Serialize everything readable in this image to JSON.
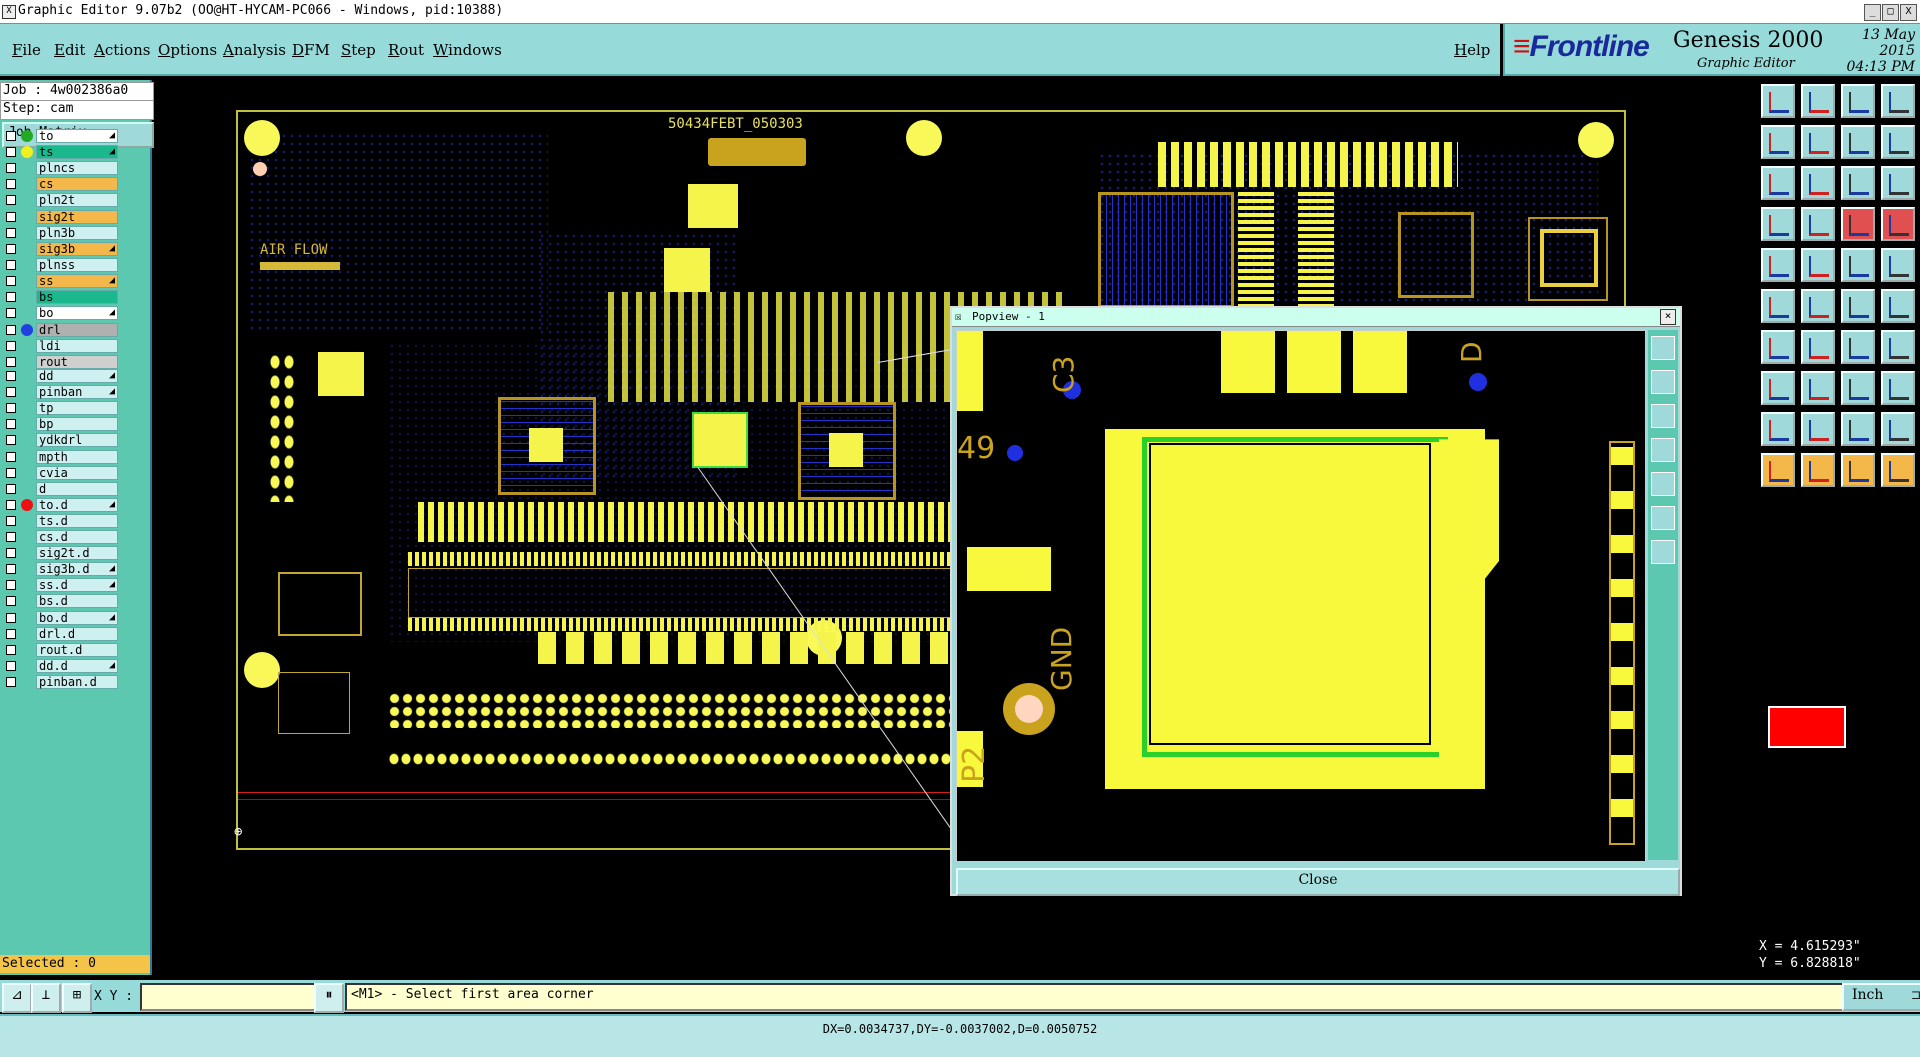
{
  "window": {
    "title": "Graphic Editor 9.07b2 (OO@HT-HYCAM-PC066 - Windows, pid:10388)",
    "buttons": [
      "_",
      "□",
      "X"
    ]
  },
  "menu": {
    "items": [
      "File",
      "Edit",
      "Actions",
      "Options",
      "Analysis",
      "DFM",
      "Step",
      "Rout",
      "Windows"
    ],
    "help": "Help"
  },
  "brand": {
    "logo": "Frontline",
    "product": "Genesis 2000",
    "subtitle": "Graphic Editor",
    "date": "13 May 2015",
    "time": "04:13 PM"
  },
  "job": {
    "job_label": "Job : 4w002386a0",
    "step_label": "Step: cam",
    "matrix_button": "Job Matrix ..."
  },
  "layers": [
    {
      "name": "to",
      "dot": "#22aa22",
      "color": "#ffffff",
      "arrow": true
    },
    {
      "name": "ts",
      "dot": "#f0f020",
      "color": "#1ab88c",
      "arrow": true
    },
    {
      "name": "plncs",
      "dot": "",
      "color": "#cff0f0",
      "arrow": false
    },
    {
      "name": "cs",
      "dot": "",
      "color": "#f4b84a",
      "arrow": false
    },
    {
      "name": "pln2t",
      "dot": "",
      "color": "#cff0f0",
      "arrow": false
    },
    {
      "name": "sig2t",
      "dot": "",
      "color": "#f4b84a",
      "arrow": false
    },
    {
      "name": "pln3b",
      "dot": "",
      "color": "#cff0f0",
      "arrow": false
    },
    {
      "name": "sig3b",
      "dot": "",
      "color": "#f4b84a",
      "arrow": true
    },
    {
      "name": "plnss",
      "dot": "",
      "color": "#cff0f0",
      "arrow": false
    },
    {
      "name": "ss",
      "dot": "",
      "color": "#f4b84a",
      "arrow": true
    },
    {
      "name": "bs",
      "dot": "",
      "color": "#1ab88c",
      "arrow": false
    },
    {
      "name": "bo",
      "dot": "",
      "color": "#ffffff",
      "arrow": true
    },
    {
      "name": "drl",
      "dot": "#2040e0",
      "color": "#b0b0b0",
      "arrow": false
    },
    {
      "name": "ldi",
      "dot": "",
      "color": "#cff0f0",
      "arrow": false
    },
    {
      "name": "rout",
      "dot": "",
      "color": "#cfcfcf",
      "arrow": false
    },
    {
      "name": "dd",
      "dot": "",
      "color": "#cff0f0",
      "arrow": true
    },
    {
      "name": "pinban",
      "dot": "",
      "color": "#cff0f0",
      "arrow": true
    },
    {
      "name": "tp",
      "dot": "",
      "color": "#cff0f0",
      "arrow": false
    },
    {
      "name": "bp",
      "dot": "",
      "color": "#cff0f0",
      "arrow": false
    },
    {
      "name": "ydkdrl",
      "dot": "",
      "color": "#cff0f0",
      "arrow": false
    },
    {
      "name": "mpth",
      "dot": "",
      "color": "#cff0f0",
      "arrow": false
    },
    {
      "name": "cvia",
      "dot": "",
      "color": "#cff0f0",
      "arrow": false
    },
    {
      "name": "d",
      "dot": "",
      "color": "#cff0f0",
      "arrow": false
    },
    {
      "name": "to.d",
      "dot": "#ee1111",
      "color": "#cff0f0",
      "arrow": true
    },
    {
      "name": "ts.d",
      "dot": "",
      "color": "#cff0f0",
      "arrow": false
    },
    {
      "name": "cs.d",
      "dot": "",
      "color": "#cff0f0",
      "arrow": false
    },
    {
      "name": "sig2t.d",
      "dot": "",
      "color": "#cff0f0",
      "arrow": false
    },
    {
      "name": "sig3b.d",
      "dot": "",
      "color": "#cff0f0",
      "arrow": true
    },
    {
      "name": "ss.d",
      "dot": "",
      "color": "#cff0f0",
      "arrow": true
    },
    {
      "name": "bs.d",
      "dot": "",
      "color": "#cff0f0",
      "arrow": false
    },
    {
      "name": "bo.d",
      "dot": "",
      "color": "#cff0f0",
      "arrow": true
    },
    {
      "name": "drl.d",
      "dot": "",
      "color": "#cff0f0",
      "arrow": false
    },
    {
      "name": "rout.d",
      "dot": "",
      "color": "#cff0f0",
      "arrow": false
    },
    {
      "name": "dd.d",
      "dot": "",
      "color": "#cff0f0",
      "arrow": true
    },
    {
      "name": "pinban.d",
      "dot": "",
      "color": "#cff0f0",
      "arrow": false
    }
  ],
  "selected": "Selected : 0",
  "board": {
    "part_number": "50434FEBT_050303",
    "airflow": "AIR FLOW"
  },
  "popview": {
    "title": "Popview - 1",
    "close": "Close",
    "labels": [
      "C3",
      "49",
      "GND",
      "D",
      "P2"
    ]
  },
  "coords": {
    "x": "X = 4.615293\"",
    "y": "Y = 6.828818\""
  },
  "cmd": {
    "xy_label": "X Y :",
    "prompt": "<M1> - Select first area corner",
    "unit": "Inch"
  },
  "status": "DX=0.0034737,DY=-0.0037002,D=0.0050752"
}
